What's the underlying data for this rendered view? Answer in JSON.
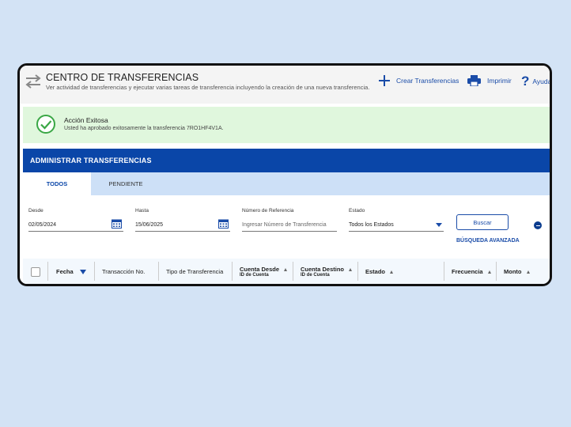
{
  "header": {
    "title": "CENTRO DE TRANSFERENCIAS",
    "subtitle": "Ver actividad de transferencias y ejecutar varias tareas de transferencia incluyendo la creación de una nueva transferencia.",
    "actions": {
      "create": "Crear Transferencias",
      "print": "Imprimir",
      "help": "Ayuda"
    }
  },
  "success": {
    "title": "Acción Exitosa",
    "message": "Usted ha aprobado exitosamente la transferencia 7RO1HF4V1A."
  },
  "admin": {
    "title": "ADMINISTRAR TRANSFERENCIAS",
    "tabs": [
      {
        "label": "TODOS",
        "active": true
      },
      {
        "label": "PENDIENTE",
        "active": false
      }
    ]
  },
  "filters": {
    "desde": {
      "label": "Desde",
      "value": "02/05/2024"
    },
    "hasta": {
      "label": "Hasta",
      "value": "15/06/2025"
    },
    "referencia": {
      "label": "Número de Referencia",
      "placeholder": "Ingresar Número de Transferencia"
    },
    "estado": {
      "label": "Estado",
      "value": "Todos los Estados"
    },
    "search_button": "Buscar",
    "advanced_link": "BÚSQUEDA AVANZADA"
  },
  "table": {
    "columns": {
      "fecha": "Fecha",
      "transaccion": "Transacción No.",
      "tipo": "Tipo de Transferencia",
      "desde": "Cuenta Desde",
      "desde_sub": "ID de Cuenta",
      "destino": "Cuenta Destino",
      "destino_sub": "ID de Cuenta",
      "estado": "Estado",
      "frecuencia": "Frecuencia",
      "monto": "Monto"
    }
  },
  "colors": {
    "brand": "#0a46a8",
    "success_bg": "#e0f7dd",
    "success_icon": "#3aa745",
    "page_bg": "#d3e3f5"
  },
  "icons": {
    "transfer": "transfer-arrows-icon",
    "create": "plus-icon",
    "print": "printer-icon",
    "help": "question-icon",
    "success": "check-circle-icon",
    "calendar": "calendar-icon",
    "select": "dropdown-caret-icon"
  }
}
